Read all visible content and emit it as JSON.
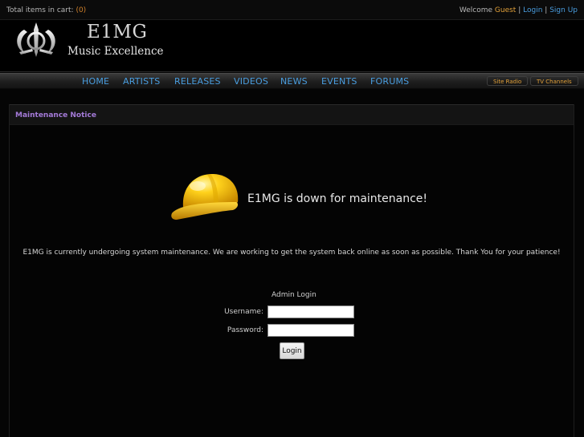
{
  "topbar": {
    "cart_label": "Total items in cart:",
    "cart_count": "(0)",
    "welcome": "Welcome",
    "user": "Guest",
    "sep1": "|",
    "login": "Login",
    "sep2": "|",
    "signup": "Sign Up"
  },
  "header": {
    "logo_title": "E1MG",
    "logo_tagline": "Music Excellence"
  },
  "nav": {
    "items": [
      "HOME",
      "ARTISTS",
      "RELEASES",
      "VIDEOS",
      "NEWS",
      "EVENTS",
      "FORUMS"
    ],
    "site_radio": "Site Radio",
    "tv_channels": "TV Channels"
  },
  "panel": {
    "title": "Maintenance Notice",
    "headline": "E1MG is down for maintenance!",
    "message": "E1MG is currently undergoing system maintenance. We are working to get the system back online as soon as possible. Thank You for your patience!"
  },
  "admin": {
    "title": "Admin Login",
    "username_label": "Username:",
    "password_label": "Password:",
    "username_value": "",
    "password_value": "",
    "login_button": "Login"
  },
  "colors": {
    "link": "#4a9ee0",
    "accent": "#e2a13a",
    "panel_title": "#a47ad8"
  }
}
